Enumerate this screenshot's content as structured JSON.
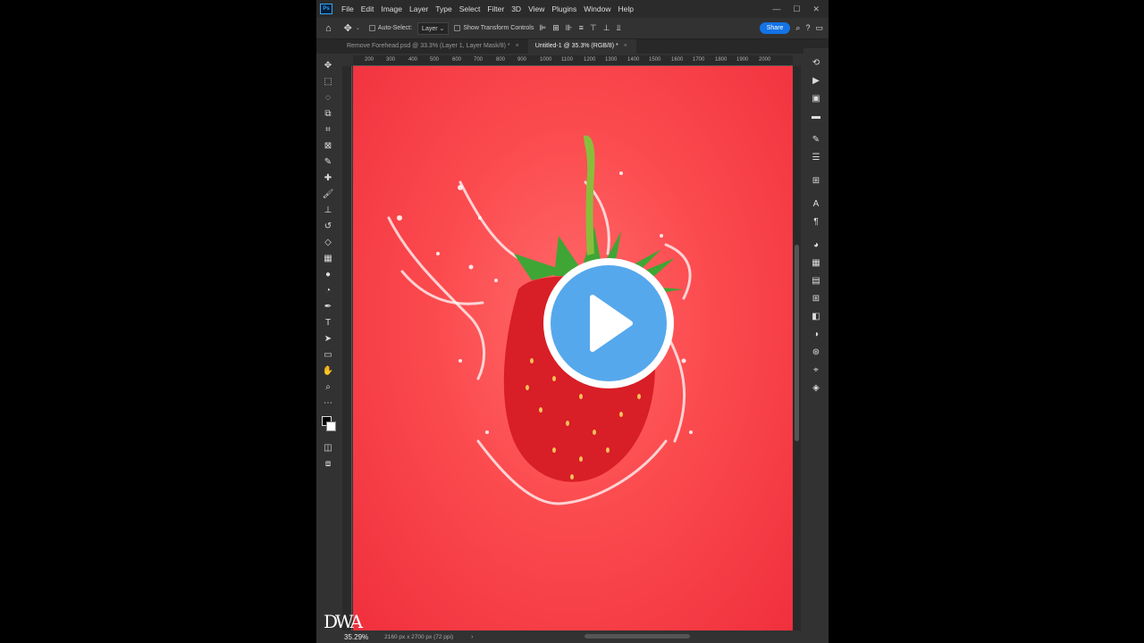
{
  "menubar": {
    "logo": "Ps",
    "items": [
      "File",
      "Edit",
      "Image",
      "Layer",
      "Type",
      "Select",
      "Filter",
      "3D",
      "View",
      "Plugins",
      "Window",
      "Help"
    ],
    "window_controls": [
      "—",
      "☐",
      "✕"
    ]
  },
  "options": {
    "auto_select_label": "Auto-Select:",
    "auto_select_target": "Layer",
    "show_transform_label": "Show Transform Controls",
    "share_label": "Share"
  },
  "tabs": [
    {
      "label": "Remove Forehead.psd @ 33.3% (Layer 1, Layer Mask/8) *",
      "active": false
    },
    {
      "label": "Untitled-1 @ 35.3% (RGB/8) *",
      "active": true
    }
  ],
  "ruler": {
    "ticks": [
      "200",
      "300",
      "400",
      "500",
      "600",
      "700",
      "800",
      "900",
      "1000",
      "1100",
      "1200",
      "1300",
      "1400",
      "1500",
      "1600",
      "1700",
      "1800",
      "1900",
      "2000"
    ]
  },
  "status": {
    "zoom": "35.29%",
    "doc_info": "2160 px x 2700 px (72 ppi)",
    "arrow": "›"
  },
  "watermark": "DWA",
  "colors": {
    "canvas_red": "#fb4a4e",
    "play_blue": "#56a8ec",
    "share_blue": "#1473e6"
  },
  "icons": {
    "tools": [
      "move-icon",
      "marquee-icon",
      "lasso-icon",
      "object-select-icon",
      "crop-icon",
      "frame-icon",
      "eyedropper-icon",
      "healing-icon",
      "brush-icon",
      "stamp-icon",
      "history-brush-icon",
      "eraser-icon",
      "gradient-icon",
      "blur-icon",
      "dodge-icon",
      "pen-icon",
      "type-icon",
      "path-select-icon",
      "rectangle-icon",
      "hand-icon",
      "zoom-icon",
      "more-tools-icon"
    ]
  }
}
